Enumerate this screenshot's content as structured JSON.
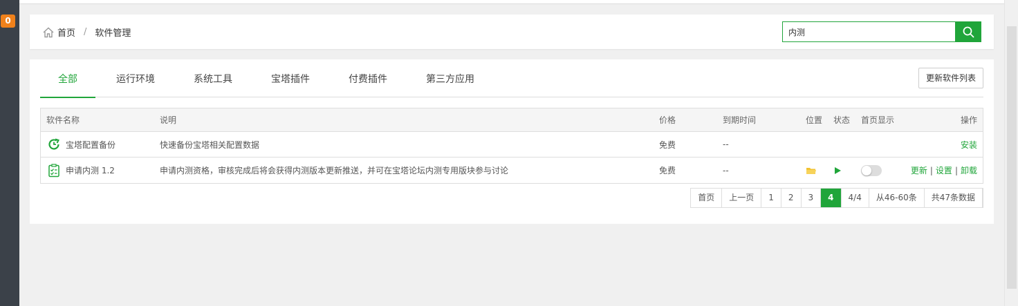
{
  "sidebar": {
    "badge": "0"
  },
  "breadcrumb": {
    "home": "首页",
    "separator": "/",
    "current": "软件管理"
  },
  "search": {
    "value": "内测",
    "placeholder": ""
  },
  "tabs": [
    {
      "label": "全部",
      "active": true
    },
    {
      "label": "运行环境"
    },
    {
      "label": "系统工具"
    },
    {
      "label": "宝塔插件"
    },
    {
      "label": "付费插件"
    },
    {
      "label": "第三方应用"
    }
  ],
  "update_button": "更新软件列表",
  "table": {
    "headers": {
      "name": "软件名称",
      "desc": "说明",
      "price": "价格",
      "expire": "到期时间",
      "position": "位置",
      "state": "状态",
      "home": "首页显示",
      "op": "操作"
    },
    "rows": [
      {
        "name": "宝塔配置备份",
        "icon": "backup-icon",
        "desc": "快速备份宝塔相关配置数据",
        "price": "免费",
        "expire": "--",
        "op": [
          "安装"
        ]
      },
      {
        "name": "申请内测 1.2",
        "icon": "checklist-icon",
        "desc": "申请内测资格，审核完成后将会获得内测版本更新推送，并可在宝塔论坛内测专用版块参与讨论",
        "price": "免费",
        "expire": "--",
        "op": [
          "更新",
          "设置",
          "卸载"
        ],
        "op_sep": "|"
      }
    ]
  },
  "pager": {
    "first": "首页",
    "prev": "上一页",
    "pages": [
      "1",
      "2",
      "3",
      "4"
    ],
    "current": "4",
    "ratio": "4/4",
    "range": "从46-60条",
    "total": "共47条数据"
  },
  "colors": {
    "accent": "#20a53a",
    "badge": "#f0811b",
    "sidebar": "#3b4149",
    "folder": "#f2c230"
  }
}
